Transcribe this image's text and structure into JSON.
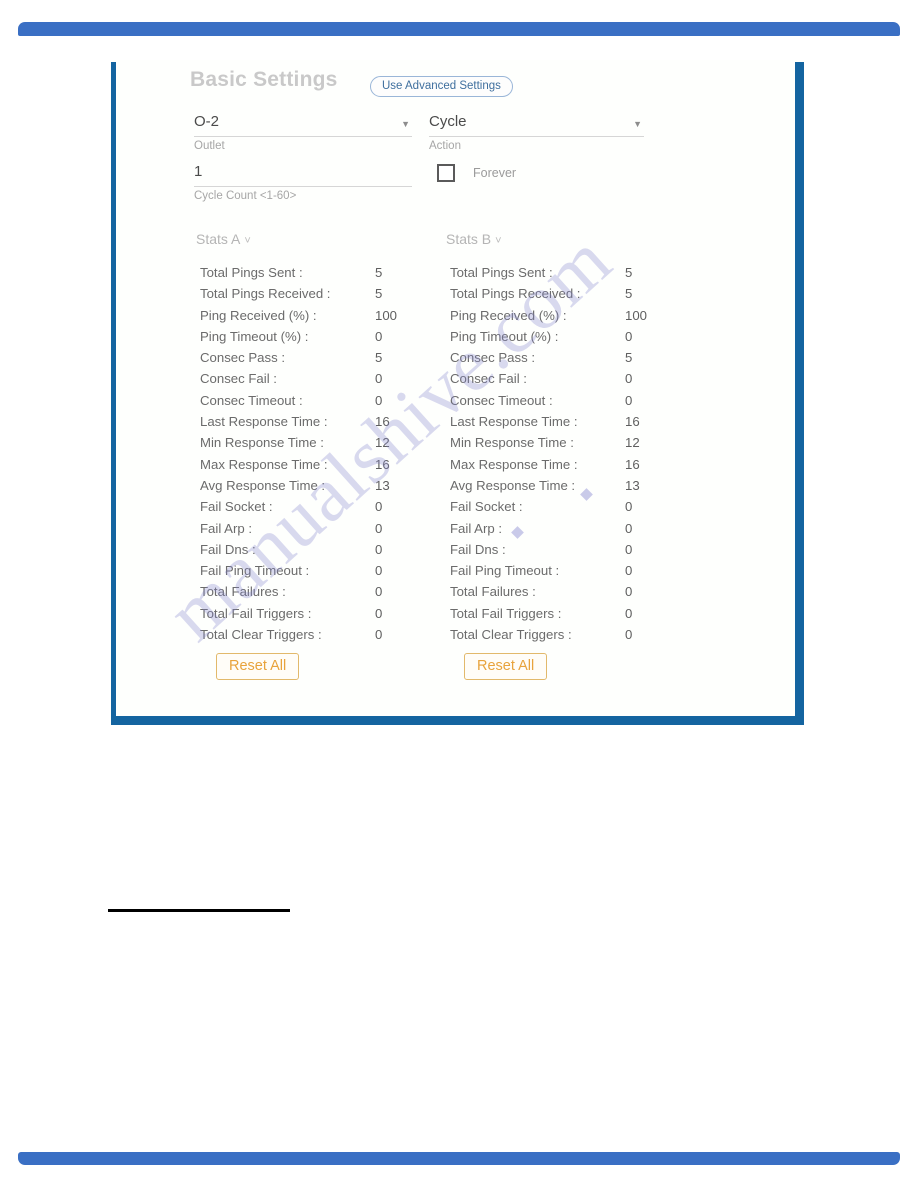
{
  "page": {
    "watermark_text": "manualshive.com"
  },
  "card": {
    "title": "Basic Settings",
    "advanced_button": "Use Advanced Settings",
    "accent_blue": "#1464a0",
    "bar_blue": "#3a6fc4",
    "reset_orange": "#e8a33c"
  },
  "form": {
    "outlet": {
      "value": "O-2",
      "label": "Outlet",
      "caret_icon": "chevron-down-icon"
    },
    "action": {
      "value": "Cycle",
      "label": "Action",
      "caret_icon": "chevron-down-icon"
    },
    "cycle_count": {
      "value": "1",
      "label": "Cycle Count <1-60>"
    },
    "forever": {
      "label": "Forever",
      "checked": false
    }
  },
  "stats_a": {
    "heading": "Stats A",
    "chevron": "ˇ",
    "reset_label": "Reset All",
    "rows": [
      {
        "label": "Total Pings Sent :",
        "value": "5"
      },
      {
        "label": "Total Pings Received :",
        "value": "5"
      },
      {
        "label": "Ping Received (%) :",
        "value": "100"
      },
      {
        "label": "Ping Timeout (%) :",
        "value": "0"
      },
      {
        "label": "Consec Pass :",
        "value": "5"
      },
      {
        "label": "Consec Fail :",
        "value": "0"
      },
      {
        "label": "Consec Timeout :",
        "value": "0"
      },
      {
        "label": "Last Response Time :",
        "value": "16"
      },
      {
        "label": "Min Response Time :",
        "value": "12"
      },
      {
        "label": "Max Response Time :",
        "value": "16"
      },
      {
        "label": "Avg Response Time :",
        "value": "13"
      },
      {
        "label": "Fail Socket :",
        "value": "0"
      },
      {
        "label": "Fail Arp :",
        "value": "0"
      },
      {
        "label": "Fail Dns :",
        "value": "0"
      },
      {
        "label": "Fail Ping Timeout :",
        "value": "0"
      },
      {
        "label": "Total Failures :",
        "value": "0"
      },
      {
        "label": "Total Fail Triggers :",
        "value": "0"
      },
      {
        "label": "Total Clear Triggers :",
        "value": "0"
      }
    ]
  },
  "stats_b": {
    "heading": "Stats B",
    "chevron": "ˇ",
    "reset_label": "Reset All",
    "rows": [
      {
        "label": "Total Pings Sent :",
        "value": "5"
      },
      {
        "label": "Total Pings Received :",
        "value": "5"
      },
      {
        "label": "Ping Received (%) :",
        "value": "100"
      },
      {
        "label": "Ping Timeout (%) :",
        "value": "0"
      },
      {
        "label": "Consec Pass :",
        "value": "5"
      },
      {
        "label": "Consec Fail :",
        "value": "0"
      },
      {
        "label": "Consec Timeout :",
        "value": "0"
      },
      {
        "label": "Last Response Time :",
        "value": "16"
      },
      {
        "label": "Min Response Time :",
        "value": "12"
      },
      {
        "label": "Max Response Time :",
        "value": "16"
      },
      {
        "label": "Avg Response Time :",
        "value": "13"
      },
      {
        "label": "Fail Socket :",
        "value": "0"
      },
      {
        "label": "Fail Arp :",
        "value": "0"
      },
      {
        "label": "Fail Dns :",
        "value": "0"
      },
      {
        "label": "Fail Ping Timeout :",
        "value": "0"
      },
      {
        "label": "Total Failures :",
        "value": "0"
      },
      {
        "label": "Total Fail Triggers :",
        "value": "0"
      },
      {
        "label": "Total Clear Triggers :",
        "value": "0"
      }
    ]
  }
}
